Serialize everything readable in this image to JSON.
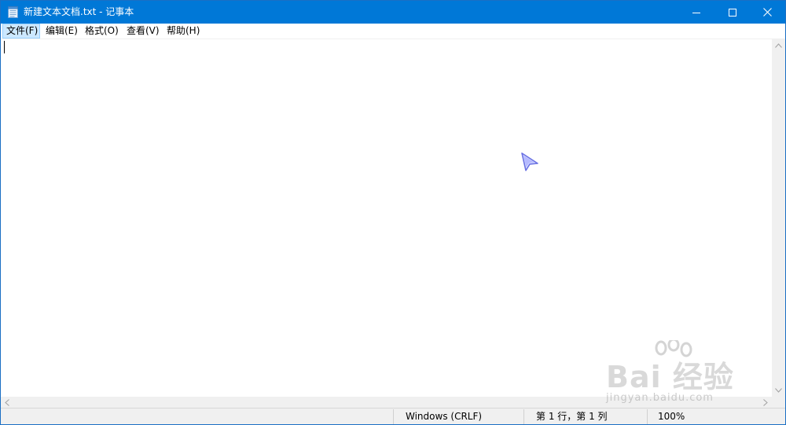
{
  "window": {
    "title": "新建文本文档.txt - 记事本",
    "accent_color": "#0078d7",
    "controls": {
      "minimize_icon": "minimize-icon",
      "maximize_icon": "maximize-icon",
      "close_icon": "close-icon"
    }
  },
  "menu": {
    "items": [
      {
        "label": "文件(F)",
        "active": true
      },
      {
        "label": "编辑(E)",
        "active": false
      },
      {
        "label": "格式(O)",
        "active": false
      },
      {
        "label": "查看(V)",
        "active": false
      },
      {
        "label": "帮助(H)",
        "active": false
      }
    ]
  },
  "editor": {
    "content": ""
  },
  "statusbar": {
    "encoding": "Windows (CRLF)",
    "position": "第 1 行，第 1 列",
    "zoom": "100%"
  },
  "watermark": {
    "brand": "Bai  经验",
    "url": "jingyan.baidu.com"
  }
}
